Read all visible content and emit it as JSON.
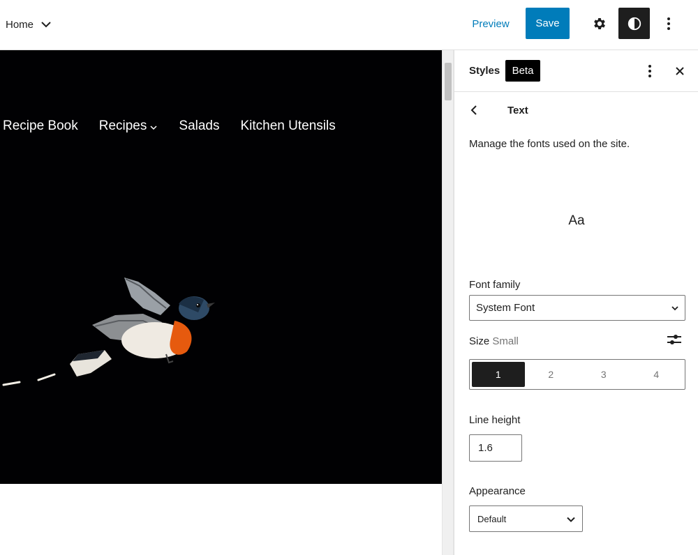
{
  "header": {
    "document_title": "Home",
    "preview_label": "Preview",
    "save_label": "Save"
  },
  "canvas": {
    "nav_items": [
      "Recipe Book",
      "Recipes",
      "Salads",
      "Kitchen Utensils"
    ]
  },
  "sidebar": {
    "title": "Styles",
    "badge": "Beta",
    "panel_title": "Text",
    "description": "Manage the fonts used on the site.",
    "preview_text": "Aa",
    "font_family_label": "Font family",
    "font_family_value": "System Font",
    "size_label": "Size",
    "size_value": "Small",
    "size_options": [
      "1",
      "2",
      "3",
      "4"
    ],
    "line_height_label": "Line height",
    "line_height_value": "1.6",
    "appearance_label": "Appearance",
    "appearance_value": "Default"
  },
  "colors": {
    "accent": "#007cba",
    "dark": "#1e1e1e",
    "hero_background": "#010103"
  }
}
